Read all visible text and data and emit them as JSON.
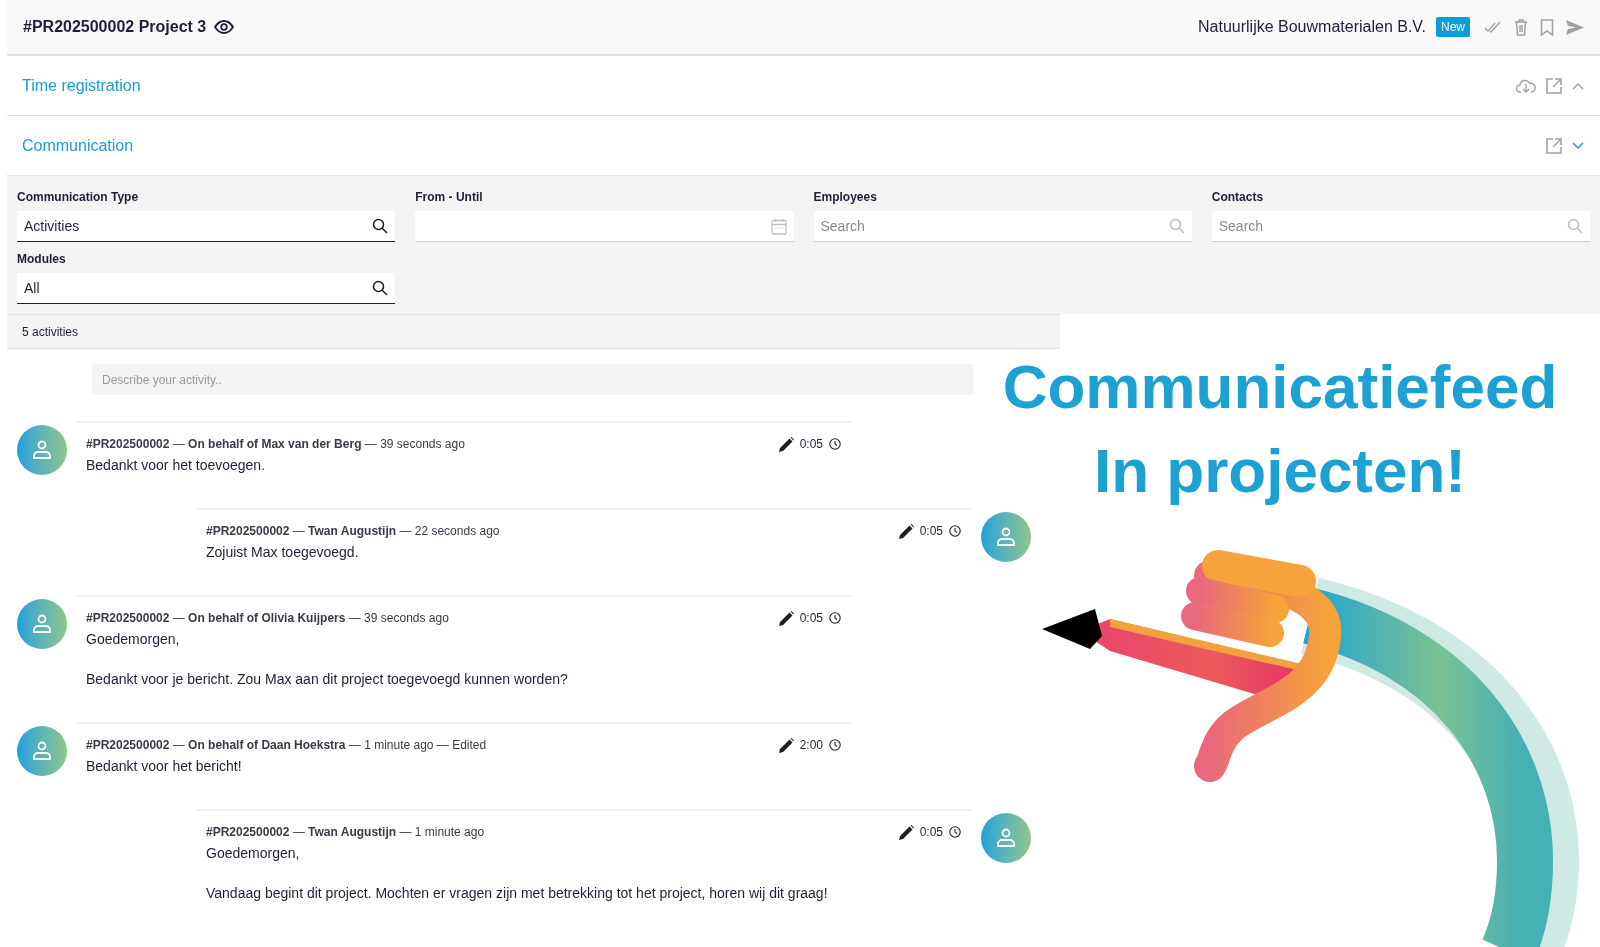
{
  "header": {
    "title": "#PR202500002 Project 3",
    "company": "Natuurlijke Bouwmaterialen B.V.",
    "status_badge": "New"
  },
  "sections": [
    {
      "kind": "registration",
      "title": "Time registration",
      "expanded": false
    },
    {
      "kind": "feed",
      "title": "Communication",
      "expanded": true
    }
  ],
  "filters": [
    {
      "label": "Communication Type",
      "value": "Activities",
      "kind": "lookup"
    },
    {
      "label": "From - Until",
      "kind": "date"
    },
    {
      "label": "Employees",
      "placeholder": "Search",
      "kind": "lookup"
    },
    {
      "label": "Contacts",
      "placeholder": "Search",
      "kind": "lookup"
    },
    {
      "label": "Modules",
      "value": "All",
      "kind": "lookup"
    }
  ],
  "activity_count": "5 activities",
  "composer": {
    "placeholder": "Describe your activity.."
  },
  "messages": [
    {
      "kind": "incoming",
      "meta": "**#PR202500002** — **On behalf of Max van der Berg** — 39 seconds ago",
      "duration": "0:05",
      "body": [
        "Bedankt voor het toevoegen."
      ]
    },
    {
      "kind": "outgoing",
      "meta": "**#PR202500002** — **Twan Augustijn** — 22 seconds ago",
      "duration": "0:05",
      "body": [
        "Zojuist Max toegevoegd."
      ]
    },
    {
      "kind": "incoming",
      "meta": "**#PR202500002** — **On behalf of Olivia Kuijpers** — 39 seconds ago",
      "duration": "0:05",
      "body": [
        "Goedemorgen,",
        "Bedankt voor je bericht. Zou Max aan dit project toegevoegd kunnen worden?"
      ]
    },
    {
      "kind": "incoming",
      "meta": "**#PR202500002** — **On behalf of Daan Hoekstra** — 1 minute ago — Edited",
      "duration": "2:00",
      "body": [
        "Bedankt voor het bericht!"
      ]
    },
    {
      "kind": "outgoing",
      "meta": "**#PR202500002** — **Twan Augustijn** — 1 minute ago",
      "duration": "0:05",
      "body": [
        "Goedemorgen,",
        "Vandaag begint dit project. Mochten er vragen zijn met betrekking tot het project, horen wij dit graag!"
      ]
    }
  ],
  "promo": {
    "headline": [
      "Communicatiefeed",
      "In projecten!"
    ]
  }
}
